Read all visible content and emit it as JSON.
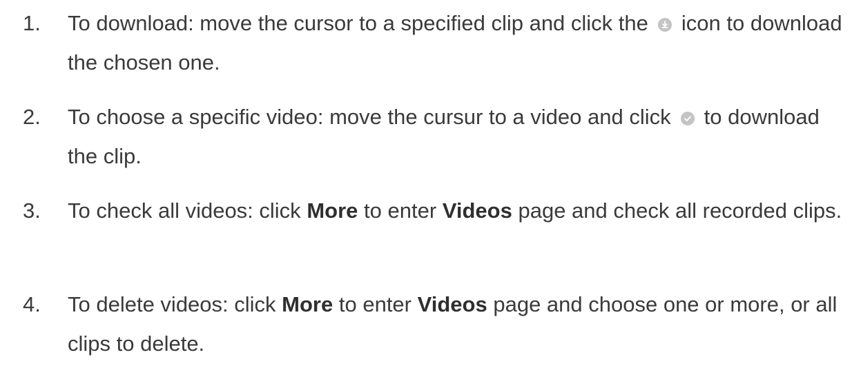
{
  "steps": [
    {
      "number": "1.",
      "text_before": "To download: move the cursor to a specified clip and click the",
      "icon": "download-icon",
      "text_after": "icon to download the chosen one."
    },
    {
      "number": "2.",
      "text_before": "To choose a specific video: move the cursur to a video and click",
      "icon": "check-icon",
      "text_after": "to download the clip."
    },
    {
      "number": "3.",
      "text_before": "To check all videos: click",
      "bold_1": "More",
      "text_mid": "to enter",
      "bold_2": "Videos",
      "text_after": "page and check all recorded clips."
    },
    {
      "number": "4.",
      "text_before": "To delete videos: click",
      "bold_1": "More",
      "text_mid": "to enter",
      "bold_2": "Videos",
      "text_after": "page and choose one or more, or all clips to delete."
    }
  ],
  "colors": {
    "text": "#3a3a3a",
    "icon_fill": "#c4c4c4",
    "icon_glyph": "#ffffff"
  }
}
